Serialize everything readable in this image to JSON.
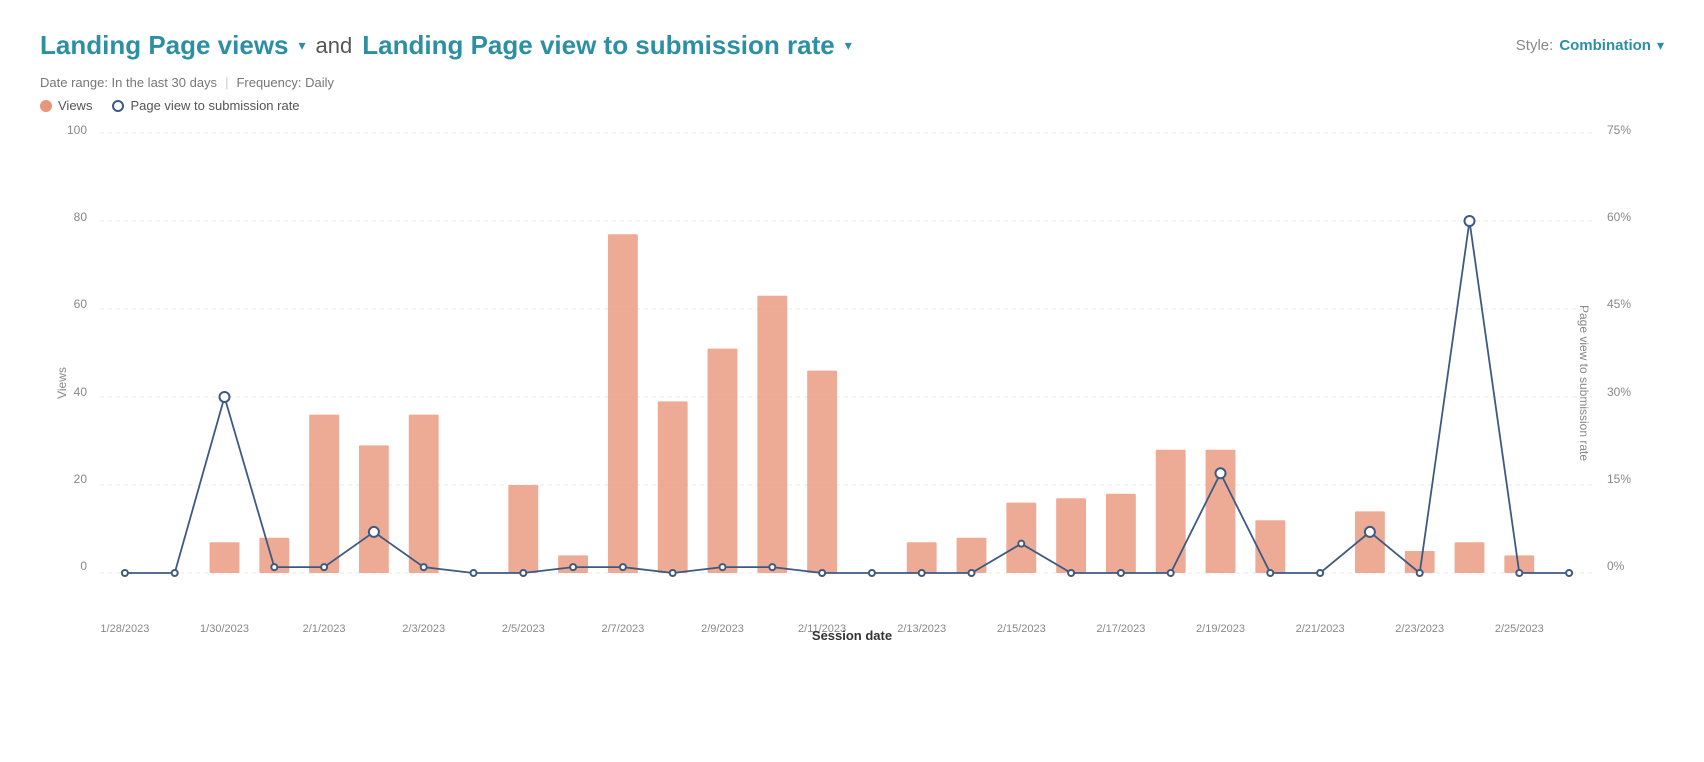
{
  "header": {
    "metric1": "Landing Page views",
    "and_text": "and",
    "metric2": "Landing Page view to submission rate",
    "style_label": "Style:",
    "style_value": "Combination"
  },
  "meta": {
    "date_range": "Date range: In the last 30 days",
    "frequency": "Frequency: Daily"
  },
  "legend": {
    "item1": "Views",
    "item2": "Page view to submission rate"
  },
  "chart": {
    "y_left_ticks": [
      "100",
      "80",
      "60",
      "40",
      "20",
      "0"
    ],
    "y_right_ticks": [
      "75%",
      "60%",
      "45%",
      "30%",
      "15%",
      "0%"
    ],
    "y_left_label": "Views",
    "y_right_label": "Page view to submission rate",
    "x_label": "Session date",
    "x_ticks": [
      "1/28/2023",
      "1/30/2023",
      "2/1/2023",
      "2/3/2023",
      "2/5/2023",
      "2/7/2023",
      "2/9/2023",
      "2/11/2023",
      "2/13/2023",
      "2/15/2023",
      "2/17/2023",
      "2/19/2023",
      "2/21/2023",
      "2/23/2023",
      "2/25/2023"
    ],
    "bars": [
      {
        "date": "1/28/2023",
        "value": 0
      },
      {
        "date": "1/29/2023",
        "value": 0
      },
      {
        "date": "1/30/2023",
        "value": 7
      },
      {
        "date": "1/31/2023",
        "value": 8
      },
      {
        "date": "2/1/2023",
        "value": 36
      },
      {
        "date": "2/2/2023",
        "value": 29
      },
      {
        "date": "2/3/2023",
        "value": 36
      },
      {
        "date": "2/4/2023",
        "value": 0
      },
      {
        "date": "2/5/2023",
        "value": 20
      },
      {
        "date": "2/6/2023",
        "value": 4
      },
      {
        "date": "2/7/2023",
        "value": 77
      },
      {
        "date": "2/8/2023",
        "value": 39
      },
      {
        "date": "2/9/2023",
        "value": 51
      },
      {
        "date": "2/10/2023",
        "value": 63
      },
      {
        "date": "2/11/2023",
        "value": 46
      },
      {
        "date": "2/12/2023",
        "value": 0
      },
      {
        "date": "2/13/2023",
        "value": 7
      },
      {
        "date": "2/14/2023",
        "value": 8
      },
      {
        "date": "2/15/2023",
        "value": 16
      },
      {
        "date": "2/16/2023",
        "value": 17
      },
      {
        "date": "2/17/2023",
        "value": 18
      },
      {
        "date": "2/18/2023",
        "value": 28
      },
      {
        "date": "2/19/2023",
        "value": 28
      },
      {
        "date": "2/20/2023",
        "value": 12
      },
      {
        "date": "2/21/2023",
        "value": 0
      },
      {
        "date": "2/22/2023",
        "value": 14
      },
      {
        "date": "2/23/2023",
        "value": 5
      },
      {
        "date": "2/24/2023",
        "value": 7
      },
      {
        "date": "2/25/2023",
        "value": 4
      },
      {
        "date": "2/26/2023",
        "value": 0
      }
    ],
    "line": [
      {
        "date": "1/28/2023",
        "value": 0
      },
      {
        "date": "1/29/2023",
        "value": 0
      },
      {
        "date": "1/30/2023",
        "value": 30
      },
      {
        "date": "1/31/2023",
        "value": 1
      },
      {
        "date": "2/1/2023",
        "value": 1
      },
      {
        "date": "2/2/2023",
        "value": 7
      },
      {
        "date": "2/3/2023",
        "value": 1
      },
      {
        "date": "2/4/2023",
        "value": 0
      },
      {
        "date": "2/5/2023",
        "value": 0
      },
      {
        "date": "2/6/2023",
        "value": 1
      },
      {
        "date": "2/7/2023",
        "value": 1
      },
      {
        "date": "2/8/2023",
        "value": 0
      },
      {
        "date": "2/9/2023",
        "value": 1
      },
      {
        "date": "2/10/2023",
        "value": 1
      },
      {
        "date": "2/11/2023",
        "value": 0
      },
      {
        "date": "2/12/2023",
        "value": 0
      },
      {
        "date": "2/13/2023",
        "value": 0
      },
      {
        "date": "2/14/2023",
        "value": 0
      },
      {
        "date": "2/15/2023",
        "value": 5
      },
      {
        "date": "2/16/2023",
        "value": 0
      },
      {
        "date": "2/17/2023",
        "value": 0
      },
      {
        "date": "2/18/2023",
        "value": 0
      },
      {
        "date": "2/19/2023",
        "value": 17
      },
      {
        "date": "2/20/2023",
        "value": 0
      },
      {
        "date": "2/21/2023",
        "value": 0
      },
      {
        "date": "2/22/2023",
        "value": 7
      },
      {
        "date": "2/23/2023",
        "value": 0
      },
      {
        "date": "2/24/2023",
        "value": 60
      },
      {
        "date": "2/25/2023",
        "value": 0
      },
      {
        "date": "2/26/2023",
        "value": 0
      }
    ]
  }
}
